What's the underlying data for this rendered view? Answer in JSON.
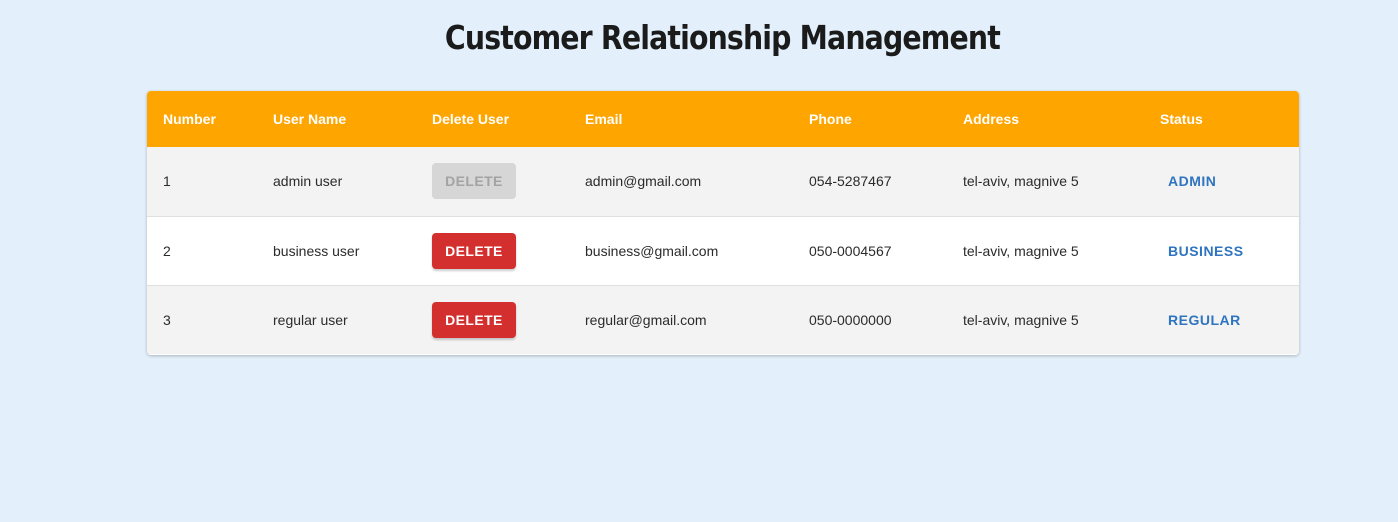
{
  "page": {
    "title": "Customer Relationship Management"
  },
  "colors": {
    "background": "#e3f0fb",
    "header": "#ffa500",
    "delete": "#d32f2f",
    "delete_disabled": "#d6d6d6",
    "status_link": "#2f74c0"
  },
  "table": {
    "headers": {
      "number": "Number",
      "user_name": "User Name",
      "delete_user": "Delete User",
      "email": "Email",
      "phone": "Phone",
      "address": "Address",
      "status": "Status"
    },
    "rows": [
      {
        "number": "1",
        "user_name": "admin user",
        "delete_label": "DELETE",
        "delete_enabled": false,
        "email": "admin@gmail.com",
        "phone": "054-5287467",
        "address": "tel-aviv, magnive 5",
        "status": "ADMIN"
      },
      {
        "number": "2",
        "user_name": "business user",
        "delete_label": "DELETE",
        "delete_enabled": true,
        "email": "business@gmail.com",
        "phone": "050-0004567",
        "address": "tel-aviv, magnive 5",
        "status": "BUSINESS"
      },
      {
        "number": "3",
        "user_name": "regular user",
        "delete_label": "DELETE",
        "delete_enabled": true,
        "email": "regular@gmail.com",
        "phone": "050-0000000",
        "address": "tel-aviv, magnive 5",
        "status": "REGULAR"
      }
    ]
  }
}
